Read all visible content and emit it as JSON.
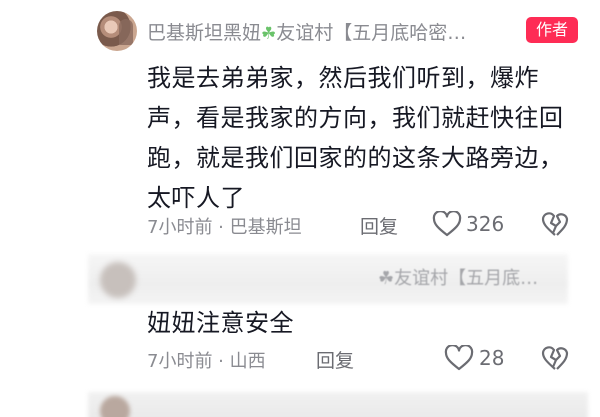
{
  "comment": {
    "username": "巴基斯坦黑妞",
    "username_suffix": "友谊村【五月底哈密…",
    "author_badge": "作者",
    "text": "我是去弟弟家，然后我们听到，爆炸声，看是我家的方向，我们就赶快往回跑，就是我们回家的的这条大路旁边，太吓人了",
    "meta": "7小时前 · 巴基斯坦",
    "reply_label": "回复",
    "like_count": "326"
  },
  "reply_comment": {
    "username_partial": "☘友谊村【五月底…",
    "text": "妞妞注意安全",
    "meta": "7小时前 · 山西",
    "reply_label": "回复",
    "like_count": "28"
  },
  "colors": {
    "badge": "#fe2c55",
    "clover": "#6ac36a",
    "muted": "#8a8b91"
  }
}
